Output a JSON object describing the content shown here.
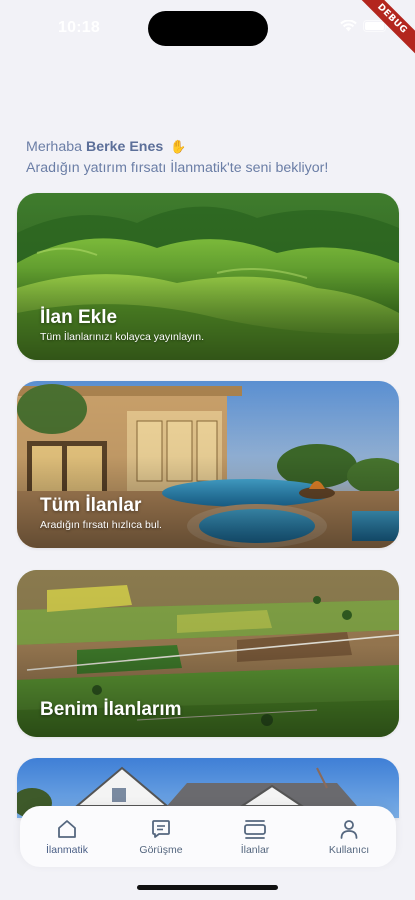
{
  "status_bar": {
    "time": "10:18",
    "debug_label": "DEBUG"
  },
  "greeting": {
    "prefix": "Merhaba",
    "user_name": "Berke Enes",
    "wave_icon": "waving-hand-icon",
    "subtitle": "Aradığın yatırım fırsatı İlanmatik'te seni bekliyor!"
  },
  "cards": [
    {
      "title": "İlan Ekle",
      "subtitle": "Tüm İlanlarınızı kolayca yayınlayın.",
      "image": "green-hills"
    },
    {
      "title": "Tüm İlanlar",
      "subtitle": "Aradığın fırsatı hızlıca bul.",
      "image": "villa-pool"
    },
    {
      "title": "Benim İlanlarım",
      "subtitle": "",
      "image": "farmland"
    },
    {
      "title": "",
      "subtitle": "",
      "image": "house-roof"
    }
  ],
  "bottom_nav": {
    "items": [
      {
        "label": "İlanmatik",
        "icon": "home-icon",
        "active": true
      },
      {
        "label": "Görüşme",
        "icon": "chat-icon",
        "active": false
      },
      {
        "label": "İlanlar",
        "icon": "listings-icon",
        "active": false
      },
      {
        "label": "Kullanıcı",
        "icon": "user-icon",
        "active": false
      }
    ]
  },
  "colors": {
    "background": "#f2f2f7",
    "greeting_text": "#6b7ea6",
    "nav_label": "#55677f",
    "debug_ribbon": "#b3261e"
  }
}
